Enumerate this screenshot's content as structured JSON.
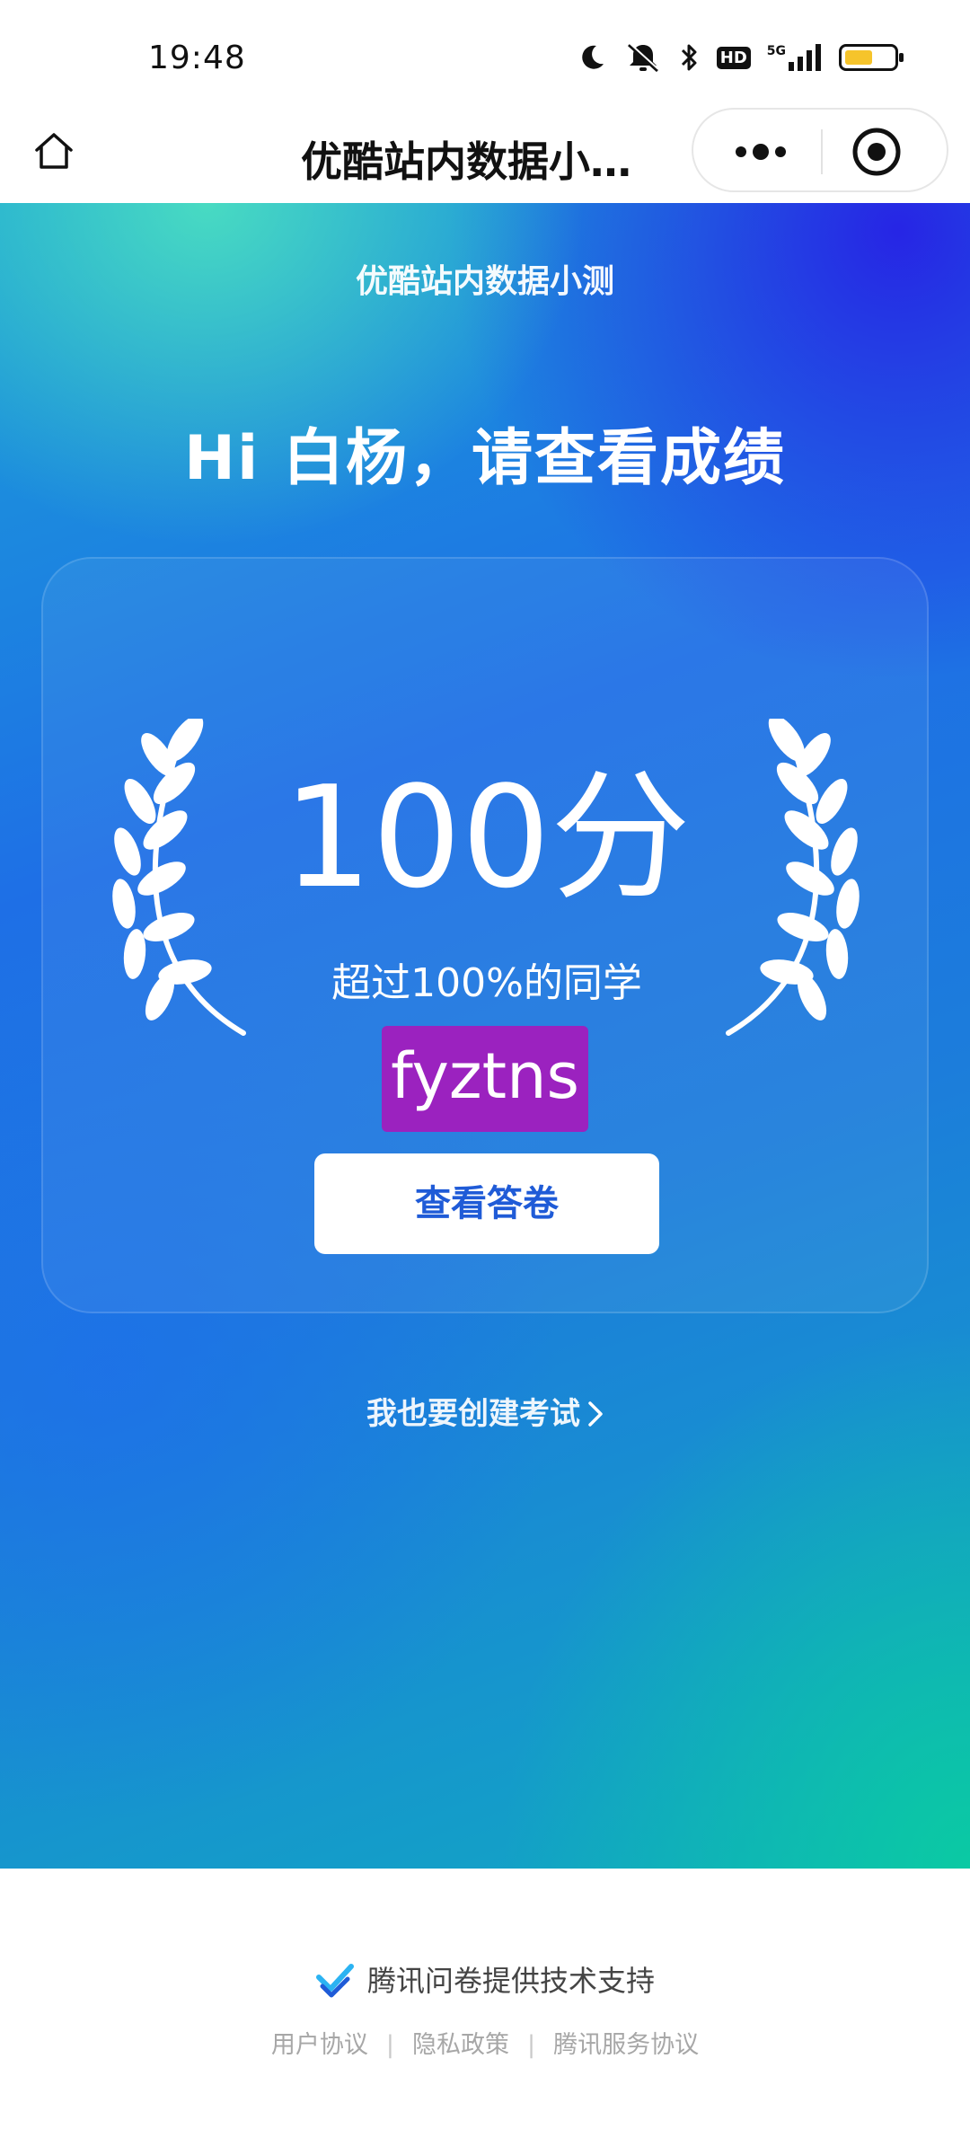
{
  "status_bar": {
    "time": "19:48",
    "icons": [
      "moon-icon",
      "mute-icon",
      "bluetooth-icon",
      "hd-icon",
      "5g-signal-icon",
      "battery-icon"
    ],
    "hd_label": "HD",
    "network_label": "5G",
    "battery_level": 0.55,
    "battery_color": "#f6c42b"
  },
  "nav": {
    "title": "优酷站内数据小…",
    "home_icon": "home-icon",
    "more_icon": "more-icon",
    "close_icon": "close-miniprogram-icon"
  },
  "hero": {
    "survey_title": "优酷站内数据小测",
    "greeting": "Hi 白杨，请查看成绩",
    "score": "100分",
    "rank_text": "超过100%的同学",
    "user_tag": "fyztns",
    "user_tag_color": "#9b22bf",
    "view_answers_label": "查看答卷",
    "create_exam_link": "我也要创建考试"
  },
  "footer": {
    "powered_by": "腾讯问卷提供技术支持",
    "links": [
      "用户协议",
      "隐私政策",
      "腾讯服务协议"
    ],
    "separator": "|"
  },
  "colors": {
    "accent": "#1f5bd7",
    "hero_start": "#1a9fd8",
    "hero_mid": "#1e6fe6",
    "hero_end": "#11a9c2"
  }
}
